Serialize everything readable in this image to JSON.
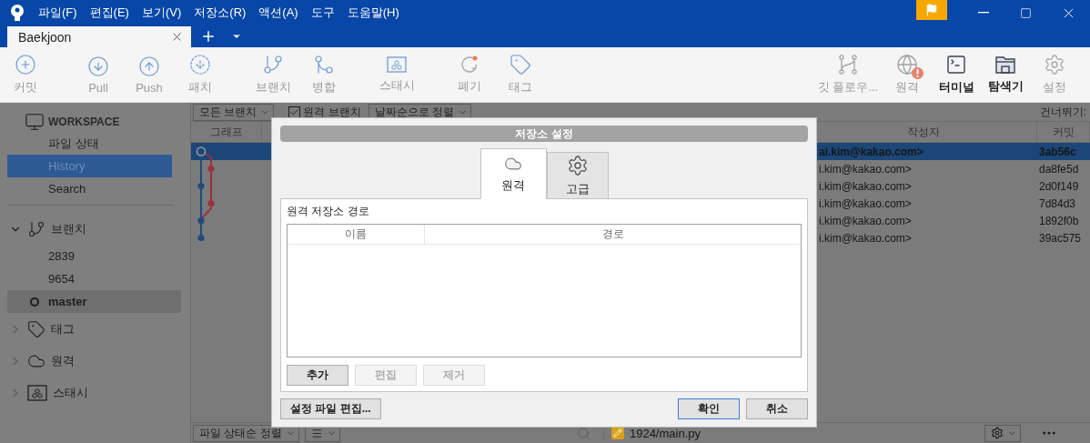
{
  "window": {
    "menus": [
      "파일(F)",
      "편집(E)",
      "보기(V)",
      "저장소(R)",
      "액션(A)",
      "도구",
      "도움말(H)"
    ]
  },
  "tabs": [
    {
      "label": "Baekjoon",
      "selected": true
    }
  ],
  "toolbar": {
    "groups": [
      [
        {
          "label": "커밋",
          "disabled": true
        }
      ],
      [
        {
          "label": "Pull",
          "disabled": true
        },
        {
          "label": "Push",
          "disabled": true
        },
        {
          "label": "패치",
          "disabled": true
        }
      ],
      [
        {
          "label": "브랜치",
          "disabled": true
        },
        {
          "label": "병합",
          "disabled": true
        }
      ],
      [
        {
          "label": "스태시",
          "disabled": true
        }
      ],
      [
        {
          "label": "폐기",
          "disabled": true
        },
        {
          "label": "태그",
          "disabled": true
        }
      ]
    ],
    "right": [
      {
        "label": "깃 플로우...",
        "disabled": true,
        "alert": false
      },
      {
        "label": "원격",
        "disabled": true,
        "alert": true
      },
      {
        "label": "터미널",
        "disabled": false,
        "alert": false
      },
      {
        "label": "탐색기",
        "disabled": false,
        "alert": false
      },
      {
        "label": "설정",
        "disabled": true,
        "alert": false
      }
    ]
  },
  "sidebar": {
    "workspace": {
      "label": "WORKSPACE",
      "items": [
        {
          "label": "파일 상태",
          "selected": false
        },
        {
          "label": "History",
          "selected": true
        },
        {
          "label": "Search",
          "selected": false
        }
      ]
    },
    "sections": [
      {
        "label": "브랜치",
        "expanded": true,
        "children": [
          {
            "label": "2839",
            "current": false
          },
          {
            "label": "9654",
            "current": false
          },
          {
            "label": "master",
            "current": true
          }
        ]
      },
      {
        "label": "태그",
        "expanded": false
      },
      {
        "label": "원격",
        "expanded": false
      },
      {
        "label": "스태시",
        "expanded": false
      }
    ]
  },
  "history": {
    "branch_filter": "모든 브랜치",
    "remote_branches": {
      "label": "원격 브랜치",
      "checked": true
    },
    "sort": "날짜순으로 정렬",
    "skip_label": "건너뛰기:",
    "columns": [
      "그래프",
      "작성자",
      "커밋"
    ],
    "rows": [
      {
        "author": "ai.kim@kakao.com>",
        "commit": "3ab56c",
        "selected": true
      },
      {
        "author": "i.kim@kakao.com>",
        "commit": "da8fe5d",
        "selected": false
      },
      {
        "author": "i.kim@kakao.com>",
        "commit": "2d0f149",
        "selected": false
      },
      {
        "author": "i.kim@kakao.com>",
        "commit": "7d84d3",
        "selected": false
      },
      {
        "author": "i.kim@kakao.com>",
        "commit": "1892f0b",
        "selected": false
      },
      {
        "author": "i.kim@kakao.com>",
        "commit": "39ac575",
        "selected": false
      }
    ]
  },
  "dialog": {
    "title": "저장소 설정",
    "tabs": [
      {
        "label": "원격",
        "selected": true
      },
      {
        "label": "고급",
        "selected": false
      }
    ],
    "section_label": "원격 저장소 경로",
    "columns": [
      "이름",
      "경로"
    ],
    "buttons": [
      {
        "label": "추가",
        "disabled": false
      },
      {
        "label": "편집",
        "disabled": true
      },
      {
        "label": "제거",
        "disabled": true
      }
    ],
    "edit_config": "설정 파일 편집...",
    "footer_buttons": [
      {
        "label": "확인",
        "default": true
      },
      {
        "label": "취소",
        "default": false
      }
    ]
  },
  "bottom_bar": {
    "sort": "파일 상태순 정렬",
    "file": "1924/main.py"
  }
}
